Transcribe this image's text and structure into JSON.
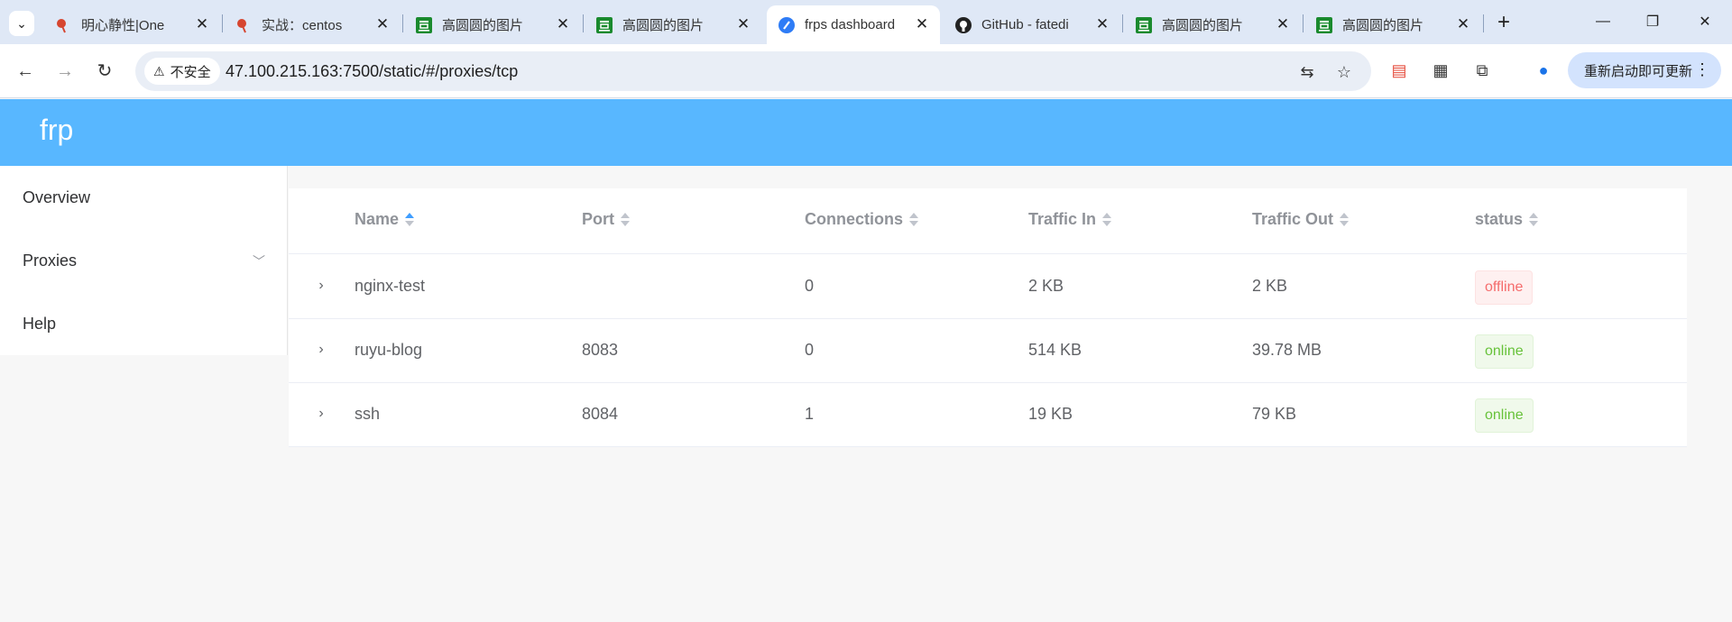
{
  "browser": {
    "tabs": [
      {
        "title": "明心静性|One",
        "favicon": "red-flower-icon"
      },
      {
        "title": "实战：centos在",
        "favicon": "red-flower-icon"
      },
      {
        "title": "高圆圆的图片",
        "favicon": "douban-icon"
      },
      {
        "title": "高圆圆的图片",
        "favicon": "douban-icon"
      },
      {
        "title": "frps dashboard",
        "favicon": "frp-icon",
        "active": true
      },
      {
        "title": "GitHub - fatedi",
        "favicon": "github-icon"
      },
      {
        "title": "高圆圆的图片",
        "favicon": "douban-icon"
      },
      {
        "title": "高圆圆的图片",
        "favicon": "douban-icon"
      }
    ],
    "security_label": "不安全",
    "url": "47.100.215.163:7500/static/#/proxies/tcp",
    "update_label": "重新启动即可更新"
  },
  "app": {
    "logo": "frp",
    "menu": [
      {
        "label": "Overview"
      },
      {
        "label": "Proxies"
      },
      {
        "label": "Help"
      }
    ]
  },
  "table": {
    "columns": [
      "Name",
      "Port",
      "Connections",
      "Traffic In",
      "Traffic Out",
      "status"
    ],
    "rows": [
      {
        "name": "nginx-test",
        "port": "",
        "connections": "0",
        "traffic_in": "2 KB",
        "traffic_out": "2 KB",
        "status": "offline"
      },
      {
        "name": "ruyu-blog",
        "port": "8083",
        "connections": "0",
        "traffic_in": "514 KB",
        "traffic_out": "39.78 MB",
        "status": "online"
      },
      {
        "name": "ssh",
        "port": "8084",
        "connections": "1",
        "traffic_in": "19 KB",
        "traffic_out": "79 KB",
        "status": "online"
      }
    ]
  },
  "colors": {
    "header": "#58b7ff",
    "offline": "#f56c6c",
    "online": "#67c23a",
    "sort_active": "#409eff"
  }
}
